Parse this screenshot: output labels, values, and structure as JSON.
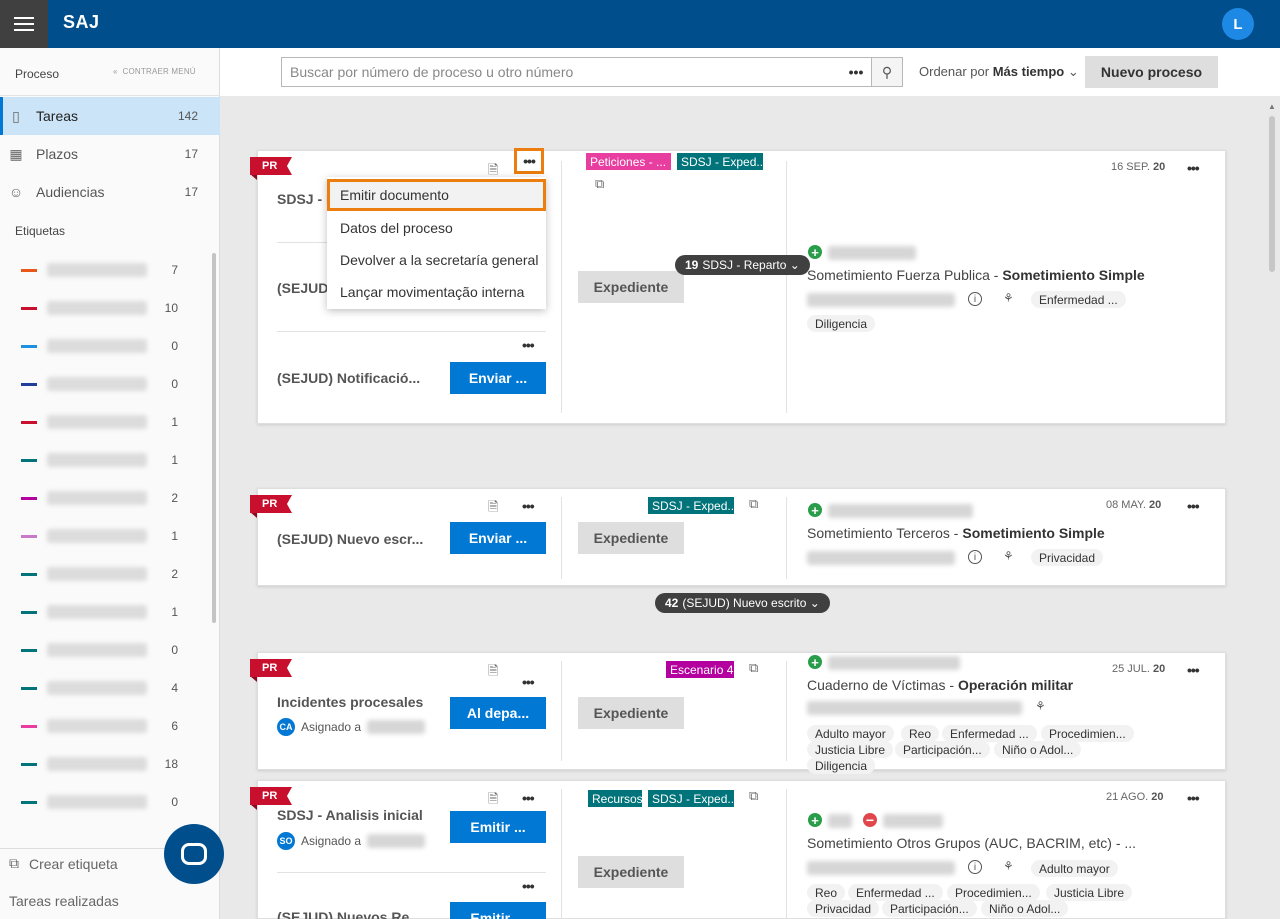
{
  "app": {
    "title": "SAJ",
    "user_initial": "L"
  },
  "sidebar": {
    "section_title": "Proceso",
    "collapse_label": "CONTRAER MENÚ",
    "nav": [
      {
        "label": "Tareas",
        "count": "142",
        "icon": "bookmark-icon"
      },
      {
        "label": "Plazos",
        "count": "17",
        "icon": "calendar-icon"
      },
      {
        "label": "Audiencias",
        "count": "17",
        "icon": "people-icon"
      }
    ],
    "tags_title": "Etiquetas",
    "tags": [
      {
        "color": "#e8571a",
        "count": "7"
      },
      {
        "color": "#c8102e",
        "count": "10"
      },
      {
        "color": "#1e90e0",
        "count": "0"
      },
      {
        "color": "#1f3f9a",
        "count": "0"
      },
      {
        "color": "#c8102e",
        "count": "1"
      },
      {
        "color": "#00747a",
        "count": "1"
      },
      {
        "color": "#b4009e",
        "count": "2"
      },
      {
        "color": "#c879c8",
        "count": "1"
      },
      {
        "color": "#00747a",
        "count": "2"
      },
      {
        "color": "#00747a",
        "count": "1"
      },
      {
        "color": "#00747a",
        "count": "0"
      },
      {
        "color": "#00747a",
        "count": "4"
      },
      {
        "color": "#e83ea0",
        "count": "6"
      },
      {
        "color": "#00747a",
        "count": "18"
      },
      {
        "color": "#00747a",
        "count": "0"
      }
    ],
    "create_tag": "Crear etiqueta",
    "done_tasks": "Tareas realizadas"
  },
  "toolbar": {
    "search_placeholder": "Buscar por número de proceso u otro número",
    "search_more": "•••",
    "order_prefix": "Ordenar por",
    "order_value": "Más tiempo",
    "new_process": "Nuevo proceso"
  },
  "menu": {
    "items": [
      "Emitir documento",
      "Datos del proceso",
      "Devolver a la secretaría general",
      "Lançar movimentação interna"
    ]
  },
  "cards": [
    {
      "badge": "PR",
      "task1": "SDSJ - R",
      "task2": "(SEJUD)",
      "task3": "(SEJUD) Notificació...",
      "task3_btn": "Enviar ...",
      "labels": [
        {
          "text": "Peticiones - ...",
          "color": "#e83ea0"
        },
        {
          "text": "SDSJ - Exped...",
          "color": "#00747a"
        }
      ],
      "expediente": "Expediente",
      "pill_count": "19",
      "pill_text": "SDSJ - Reparto",
      "date_day": "16 SEP.",
      "date_year": "20",
      "title_plain": "Sometimiento Fuerza Publica - ",
      "title_bold": "Sometimiento Simple",
      "chips": [
        "Enfermedad ...",
        "Diligencia"
      ]
    },
    {
      "badge": "PR",
      "task1": "(SEJUD) Nuevo escr...",
      "task1_btn": "Enviar ...",
      "labels": [
        {
          "text": "SDSJ - Exped...",
          "color": "#00747a"
        }
      ],
      "expediente": "Expediente",
      "pill_count": "42",
      "pill_text": "(SEJUD) Nuevo escrito",
      "date_day": "08 MAY.",
      "date_year": "20",
      "title_plain": "Sometimiento Terceros - ",
      "title_bold": "Sometimiento Simple",
      "chips": [
        "Privacidad"
      ]
    },
    {
      "badge": "PR",
      "task1": "Incidentes procesales",
      "task1_btn": "Al depa...",
      "assigned_prefix": "Asignado a",
      "assigned_initials": "CA",
      "labels": [
        {
          "text": "Escenario 4",
          "color": "#b4009e"
        }
      ],
      "expediente": "Expediente",
      "date_day": "25 JUL.",
      "date_year": "20",
      "title_plain": "Cuaderno de Víctimas - ",
      "title_bold": "Operación militar",
      "chips": [
        "Adulto mayor",
        "Reo",
        "Enfermedad ...",
        "Procedimien...",
        "Justicia Libre",
        "Participación...",
        "Niño o Adol...",
        "Diligencia"
      ]
    },
    {
      "badge": "PR",
      "task1": "SDSJ - Analisis inicial",
      "task1_btn": "Emitir ...",
      "assigned_prefix": "Asignado a",
      "assigned_initials": "SO",
      "task2": "(SEJUD) Nuevos Re...",
      "task2_btn": "Emitir ...",
      "labels": [
        {
          "text": "Recursos",
          "color": "#00747a"
        },
        {
          "text": "SDSJ - Exped...",
          "color": "#00747a"
        }
      ],
      "expediente": "Expediente",
      "date_day": "21 AGO.",
      "date_year": "20",
      "title_plain": "Sometimiento Otros Grupos (AUC, BACRIM, etc) - ...",
      "chips": [
        "Adulto mayor",
        "Reo",
        "Enfermedad ...",
        "Procedimien...",
        "Justicia Libre",
        "Privacidad",
        "Participación...",
        "Niño o Adol..."
      ]
    }
  ]
}
